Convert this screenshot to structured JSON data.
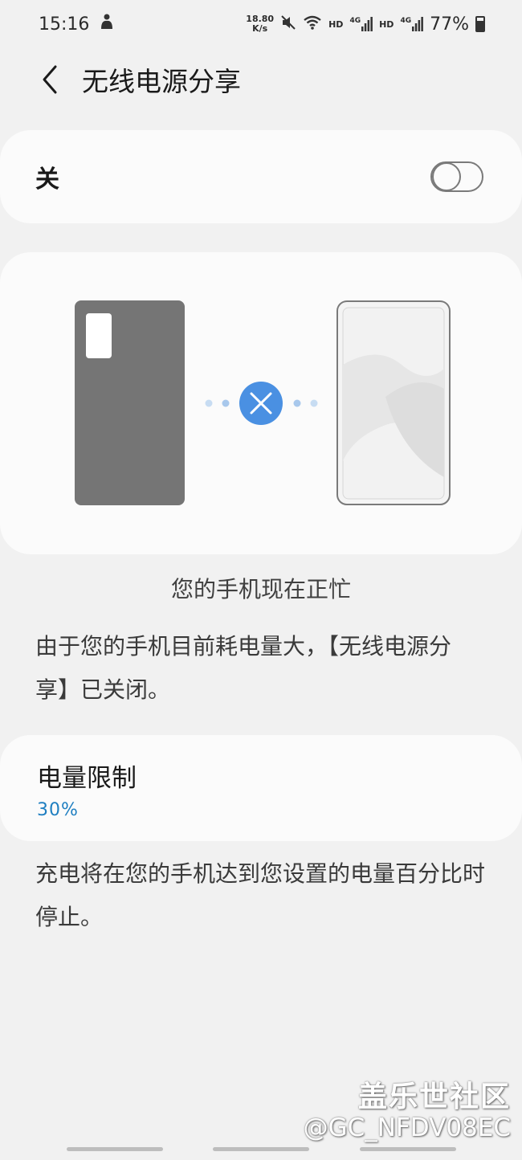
{
  "status_bar": {
    "time": "15:16",
    "net_speed_value": "18.80",
    "net_speed_unit": "K/s",
    "hd1": "HD",
    "lte1": "4G",
    "hd2": "HD",
    "lte2": "4G",
    "battery": "77%",
    "battery_level": 0.77
  },
  "header": {
    "title": "无线电源分享"
  },
  "toggle": {
    "label": "关",
    "state": "off"
  },
  "illustration": {
    "accent_color": "#4a90e2"
  },
  "busy_text": "您的手机现在正忙",
  "description": "由于您的手机目前耗电量大，【无线电源分享】已关闭。",
  "battery_limit": {
    "title": "电量限制",
    "value": "30%"
  },
  "limit_description": "充电将在您的手机达到您设置的电量百分比时停止。",
  "watermark": {
    "line1": "盖乐世社区",
    "line2": "@GC_NFDV08EC"
  }
}
